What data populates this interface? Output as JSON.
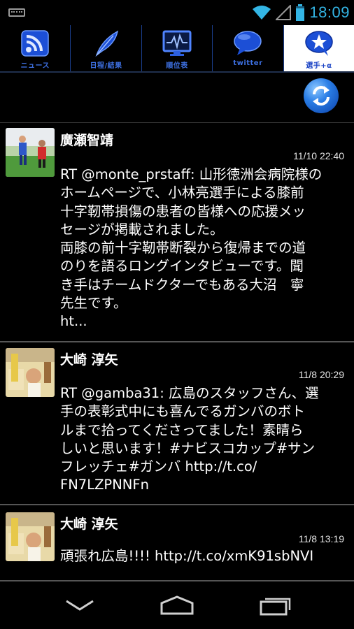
{
  "status_bar": {
    "time": "18:09",
    "icons": [
      "keyboard-icon",
      "wifi-icon",
      "signal-icon",
      "battery-icon"
    ]
  },
  "tabs": [
    {
      "label": "ニュース",
      "icon": "rss-icon",
      "active": false
    },
    {
      "label": "日程/結果",
      "icon": "feather-icon",
      "active": false
    },
    {
      "label": "順位表",
      "icon": "monitor-chart-icon",
      "active": false
    },
    {
      "label": "twitter",
      "icon": "speech-bubble-icon",
      "active": false
    },
    {
      "label": "選手+α",
      "icon": "star-bubble-icon",
      "active": true
    }
  ],
  "refresh": {
    "icon": "refresh-icon"
  },
  "tweets": [
    {
      "name": "廣瀬智靖",
      "time": "11/10 22:40",
      "text": "RT @monte_prstaff: 山形徳洲会病院様の\nホームページで、小林亮選手による膝前\n十字靭帯損傷の患者の皆様への応援メッ\nセージが掲載されました。\n両膝の前十字靭帯断裂から復帰までの道\nのりを語るロングインタビューです。聞\nき手はチームドクターでもある大沼　寧\n先生です。\nht..."
    },
    {
      "name": "大崎 淳矢",
      "time": "11/8 20:29",
      "text": "RT @gamba31: 広島のスタッフさん、選\n手の表彰式中にも喜んでるガンバのボト\nルまで拾ってくださってました！素晴ら\nしいと思います！#ナビスコカップ#サン\nフレッチェ#ガンバ http://t.co/\nFN7LZPNNFn"
    },
    {
      "name": "大崎 淳矢",
      "time": "11/8 13:19",
      "text": "頑張れ広島!!!! http://t.co/xmK91sbNVI"
    }
  ],
  "nav": {
    "back_icon": "back-chevron-icon",
    "home_icon": "home-icon",
    "recents_icon": "recents-icon"
  },
  "colors": {
    "accent": "#33b5e5",
    "tab_blue": "#1a43c5",
    "divider": "#555555"
  }
}
